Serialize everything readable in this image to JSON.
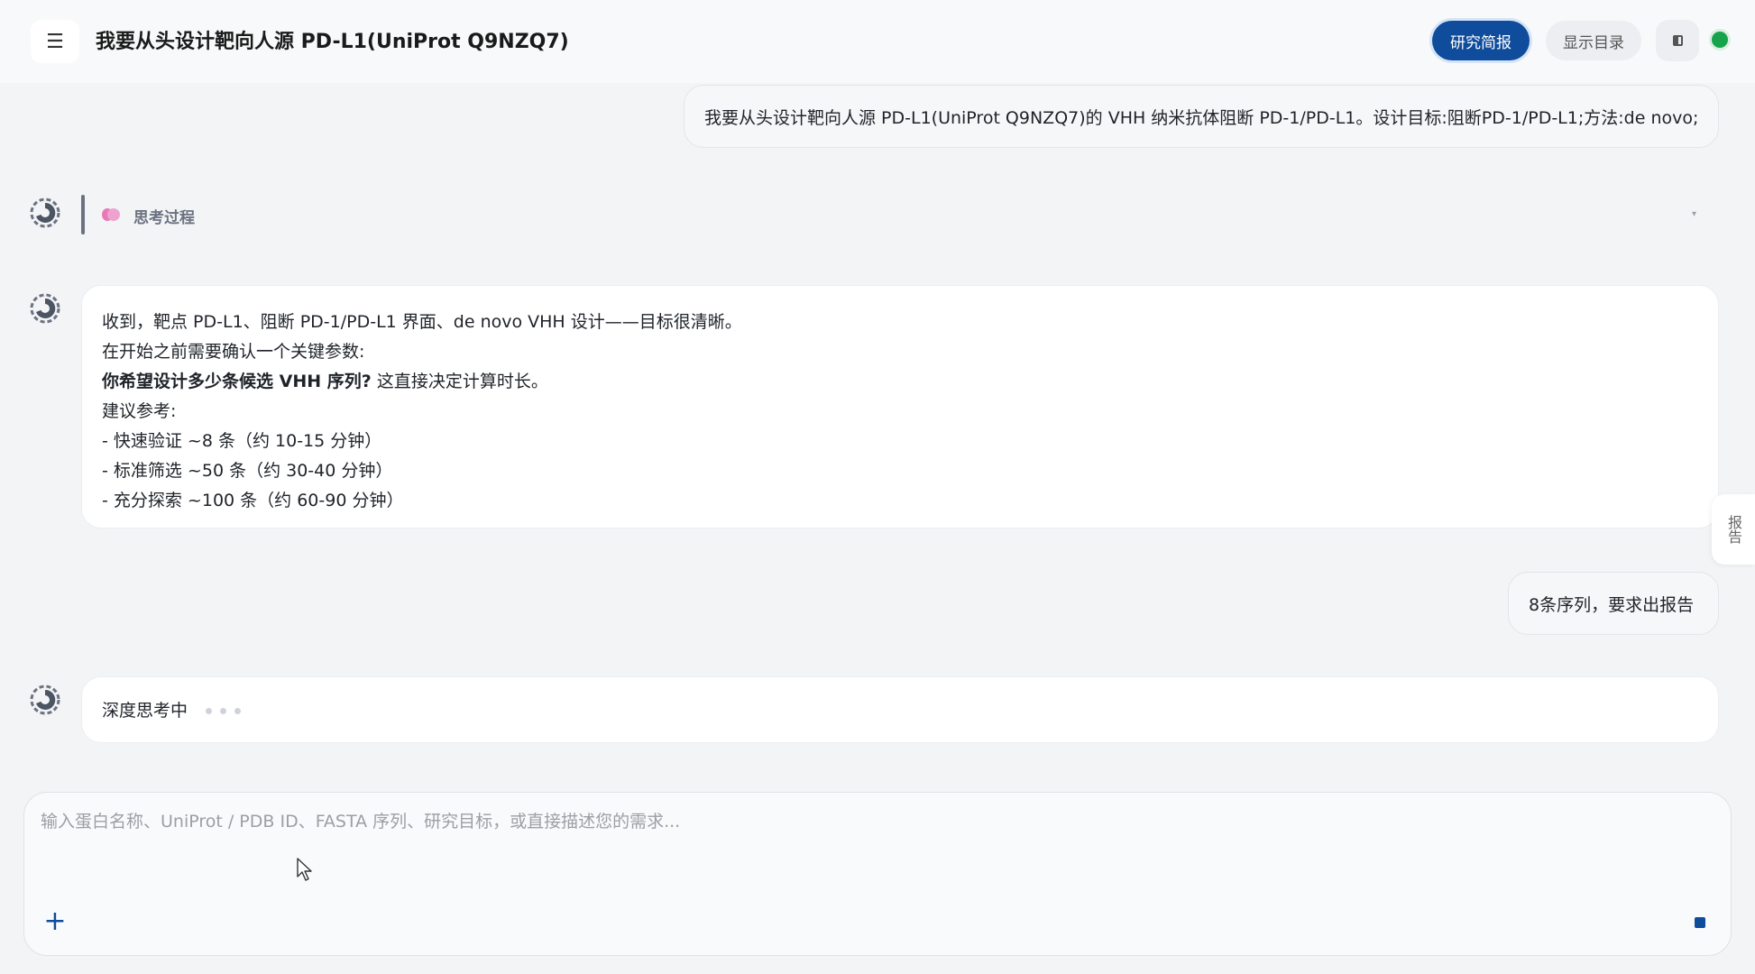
{
  "header": {
    "menu_icon": "hamburger-icon",
    "title": "我要从头设计靶向人源 PD-L1(UniProt Q9NZQ7)",
    "brief_button": "研究简报",
    "toc_button": "显示目录",
    "panel_icon": "panel-toggle-icon",
    "status_color": "#16a34a",
    "accent_color": "#0f4c9c"
  },
  "messages": {
    "user_1": "我要从头设计靶向人源 PD-L1(UniProt Q9NZQ7)的 VHH 纳米抗体阻断 PD-1/PD-L1。设计目标:阻断PD-1/PD-L1;方法:de novo;",
    "thinking_label": "思考过程",
    "assistant_1": {
      "line_1": "收到，靶点 PD-L1、阻断 PD-1/PD-L1 界面、de novo VHH 设计——目标很清晰。",
      "line_2": "在开始之前需要确认一个关键参数:",
      "line_3_bold": "你希望设计多少条候选 VHH 序列?",
      "line_3_rest": "这直接决定计算时长。",
      "line_4": "建议参考:",
      "line_5": "- 快速验证 ~8 条（约 10-15 分钟）",
      "line_6": "- 标准筛选 ~50 条（约 30-40 分钟）",
      "line_7": "- 充分探索 ~100 条（约 60-90 分钟）"
    },
    "user_2": "8条序列，要求出报告",
    "assistant_2": "深度思考中"
  },
  "side_tab": "报告",
  "composer": {
    "placeholder": "输入蛋白名称、UniProt / PDB ID、FASTA 序列、研究目标，或直接描述您的需求...",
    "add_icon": "plus-icon",
    "stop_icon": "stop-icon"
  }
}
